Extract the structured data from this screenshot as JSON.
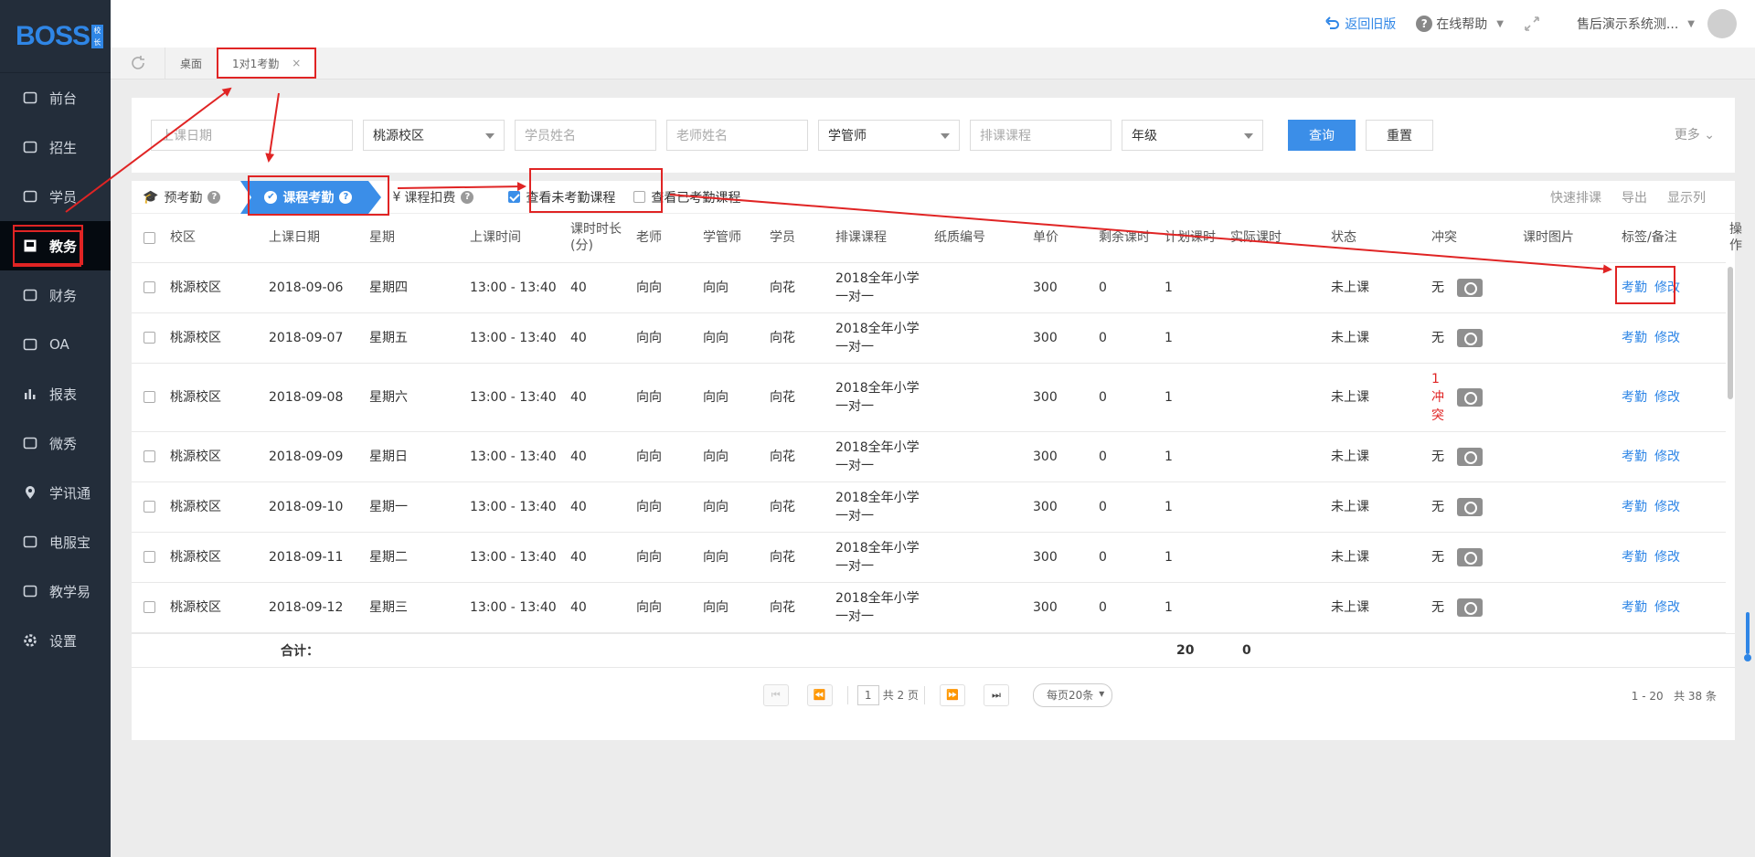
{
  "app": {
    "logo_text": "BOSS",
    "logo_badge": "校长"
  },
  "sidebar": {
    "items": [
      {
        "label": "前台",
        "icon": "calendar-icon"
      },
      {
        "label": "招生",
        "icon": "recruit-icon"
      },
      {
        "label": "学员",
        "icon": "student-icon"
      },
      {
        "label": "教务",
        "icon": "academic-icon",
        "active": true
      },
      {
        "label": "财务",
        "icon": "finance-icon"
      },
      {
        "label": "OA",
        "icon": "oa-icon"
      },
      {
        "label": "报表",
        "icon": "report-icon"
      },
      {
        "label": "微秀",
        "icon": "weixiu-icon"
      },
      {
        "label": "学讯通",
        "icon": "location-icon"
      },
      {
        "label": "电服宝",
        "icon": "phone-icon"
      },
      {
        "label": "教学易",
        "icon": "teach-icon"
      },
      {
        "label": "设置",
        "icon": "gear-icon"
      }
    ]
  },
  "topbar": {
    "back_old": "返回旧版",
    "help": "在线帮助",
    "user": "售后演示系统测..."
  },
  "tabs": {
    "desktop": "桌面",
    "current": "1对1考勤",
    "close": "×"
  },
  "filter": {
    "date_placeholder": "上课日期",
    "campus": "桃源校区",
    "student_placeholder": "学员姓名",
    "teacher_placeholder": "老师姓名",
    "manager": "学管师",
    "course_placeholder": "排课课程",
    "grade": "年级",
    "query": "查询",
    "reset": "重置",
    "more": "更多"
  },
  "steps": {
    "pre": "预考勤",
    "course": "课程考勤",
    "deduct": "课程扣费",
    "deduct_symbol": "¥",
    "show_unchecked": "查看未考勤课程",
    "show_checked": "查看已考勤课程"
  },
  "tools": {
    "quick": "快速排课",
    "export": "导出",
    "columns": "显示列"
  },
  "columns": [
    "校区",
    "上课日期",
    "星期",
    "上课时间",
    "课时时长(分)",
    "老师",
    "学管师",
    "学员",
    "排课课程",
    "纸质编号",
    "单价",
    "剩余课时",
    "计划课时",
    "实际课时",
    "状态",
    "冲突",
    "课时图片",
    "标签/备注",
    "操作"
  ],
  "rows": [
    {
      "campus": "桃源校区",
      "date": "2018-09-06",
      "weekday": "星期四",
      "time": "13:00 - 13:40",
      "duration": "40",
      "teacher": "向向",
      "manager": "向向",
      "student": "向花",
      "course": "2018全年小学一对一",
      "paper": "",
      "price": "300",
      "remaining": "0",
      "planned": "1",
      "actual": "",
      "status": "未上课",
      "conflict": "无"
    },
    {
      "campus": "桃源校区",
      "date": "2018-09-07",
      "weekday": "星期五",
      "time": "13:00 - 13:40",
      "duration": "40",
      "teacher": "向向",
      "manager": "向向",
      "student": "向花",
      "course": "2018全年小学一对一",
      "paper": "",
      "price": "300",
      "remaining": "0",
      "planned": "1",
      "actual": "",
      "status": "未上课",
      "conflict": "无"
    },
    {
      "campus": "桃源校区",
      "date": "2018-09-08",
      "weekday": "星期六",
      "time": "13:00 - 13:40",
      "duration": "40",
      "teacher": "向向",
      "manager": "向向",
      "student": "向花",
      "course": "2018全年小学一对一",
      "paper": "",
      "price": "300",
      "remaining": "0",
      "planned": "1",
      "actual": "",
      "status": "未上课",
      "conflict": "1冲突"
    },
    {
      "campus": "桃源校区",
      "date": "2018-09-09",
      "weekday": "星期日",
      "time": "13:00 - 13:40",
      "duration": "40",
      "teacher": "向向",
      "manager": "向向",
      "student": "向花",
      "course": "2018全年小学一对一",
      "paper": "",
      "price": "300",
      "remaining": "0",
      "planned": "1",
      "actual": "",
      "status": "未上课",
      "conflict": "无"
    },
    {
      "campus": "桃源校区",
      "date": "2018-09-10",
      "weekday": "星期一",
      "time": "13:00 - 13:40",
      "duration": "40",
      "teacher": "向向",
      "manager": "向向",
      "student": "向花",
      "course": "2018全年小学一对一",
      "paper": "",
      "price": "300",
      "remaining": "0",
      "planned": "1",
      "actual": "",
      "status": "未上课",
      "conflict": "无"
    },
    {
      "campus": "桃源校区",
      "date": "2018-09-11",
      "weekday": "星期二",
      "time": "13:00 - 13:40",
      "duration": "40",
      "teacher": "向向",
      "manager": "向向",
      "student": "向花",
      "course": "2018全年小学一对一",
      "paper": "",
      "price": "300",
      "remaining": "0",
      "planned": "1",
      "actual": "",
      "status": "未上课",
      "conflict": "无"
    },
    {
      "campus": "桃源校区",
      "date": "2018-09-12",
      "weekday": "星期三",
      "time": "13:00 - 13:40",
      "duration": "40",
      "teacher": "向向",
      "manager": "向向",
      "student": "向花",
      "course": "2018全年小学一对一",
      "paper": "",
      "price": "300",
      "remaining": "0",
      "planned": "1",
      "actual": "",
      "status": "未上课",
      "conflict": "无"
    }
  ],
  "row_actions": {
    "attend": "考勤",
    "edit": "修改"
  },
  "totals": {
    "label": "合计：",
    "planned": "20",
    "actual": "0"
  },
  "pager": {
    "page": "1",
    "total_pages": "共 2 页",
    "per_page": "每页20条",
    "range": "1 - 20",
    "total": "共 38 条"
  },
  "colors": {
    "accent": "#3b8ee8",
    "annotation": "#e02424",
    "sidebar": "#232d3a"
  }
}
